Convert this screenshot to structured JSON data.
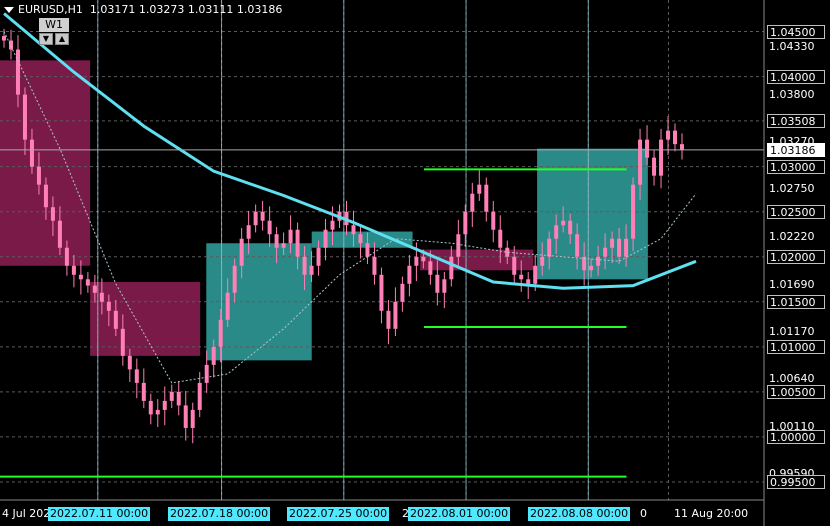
{
  "symbol": {
    "name": "EURUSD,H1",
    "ohlc": "1.03171 1.03273 1.03111 1.03186"
  },
  "timeframe_widget": {
    "label": "W1",
    "down": "▼",
    "up": "▲"
  },
  "price_axis": {
    "boxed": [
      "1.04500",
      "1.04000",
      "1.03508",
      "1.03000",
      "1.02500",
      "1.02000",
      "1.01500",
      "1.01000",
      "1.00500",
      "1.00000",
      "0.99500"
    ],
    "plain": [
      "1.04330",
      "1.03800",
      "1.03270",
      "1.02750",
      "1.02220",
      "1.01690",
      "1.01170",
      "1.00640",
      "1.00110",
      "0.99590"
    ],
    "current": "1.03186"
  },
  "time_axis": {
    "plain": [
      "4 Jul 2022",
      "2",
      "2",
      "2",
      "0",
      "11 Aug 20:00"
    ],
    "highlighted": [
      "2022.07.11 00:00",
      "2022.07.18 00:00",
      "2022.07.25 00:00",
      "2022.08.01 00:00",
      "2022.08.08 00:00"
    ]
  },
  "colors": {
    "background": "#000000",
    "grid": "#5a5a5a",
    "period_separator": "#9ad8e8",
    "candle": "#ff7fb6",
    "ma_thick": "#5fe0f0",
    "ma_thin": "#a8c8d0",
    "green_line": "#22ff22",
    "zone_magenta": "#7a1a48",
    "zone_teal": "#2a8a88",
    "highlight": "#4ee8ff"
  },
  "chart_data": {
    "type": "candlestick",
    "symbol": "EURUSD",
    "timeframe": "H1",
    "x_range": [
      "2022-07-04",
      "2022-08-11"
    ],
    "ylim": [
      0.993,
      1.0485
    ],
    "grid": true,
    "price_ticks": [
      1.045,
      1.0433,
      1.04,
      1.038,
      1.03508,
      1.0327,
      1.03,
      1.0275,
      1.025,
      1.0222,
      1.02,
      1.0169,
      1.015,
      1.0117,
      1.01,
      1.0064,
      1.005,
      1.0011,
      1.0,
      0.9959,
      0.995
    ],
    "current_price": 1.03186,
    "weekly_separators": [
      "2022-07-11",
      "2022-07-18",
      "2022-07-25",
      "2022-08-01",
      "2022-08-08"
    ],
    "close_series": [
      1.044,
      1.043,
      1.038,
      1.033,
      1.03,
      1.028,
      1.0255,
      1.024,
      1.021,
      1.019,
      1.018,
      1.0175,
      1.0168,
      1.016,
      1.015,
      1.014,
      1.012,
      1.009,
      1.0075,
      1.006,
      1.004,
      1.0025,
      1.003,
      1.004,
      1.005,
      1.0035,
      1.001,
      1.003,
      1.006,
      1.008,
      1.01,
      1.013,
      1.016,
      1.019,
      1.022,
      1.0235,
      1.025,
      1.024,
      1.0225,
      1.021,
      1.0215,
      1.023,
      1.02,
      1.018,
      1.019,
      1.021,
      1.023,
      1.024,
      1.025,
      1.0235,
      1.0225,
      1.0215,
      1.02,
      1.018,
      1.014,
      1.012,
      1.015,
      1.017,
      1.019,
      1.02,
      1.0195,
      1.018,
      1.016,
      1.0175,
      1.02,
      1.0225,
      1.025,
      1.027,
      1.028,
      1.025,
      1.023,
      1.021,
      1.02,
      1.018,
      1.0175,
      1.017,
      1.019,
      1.02,
      1.022,
      1.0235,
      1.024,
      1.0225,
      1.02,
      1.0185,
      1.019,
      1.02,
      1.021,
      1.022,
      1.02,
      1.022,
      1.028,
      1.033,
      1.031,
      1.029,
      1.033,
      1.034,
      1.0325,
      1.0319
    ],
    "ma_thick_keys": [
      [
        0,
        1.047
      ],
      [
        10,
        1.0405
      ],
      [
        20,
        1.0345
      ],
      [
        30,
        1.0295
      ],
      [
        40,
        1.0268
      ],
      [
        50,
        1.0238
      ],
      [
        60,
        1.0205
      ],
      [
        70,
        1.0172
      ],
      [
        80,
        1.0165
      ],
      [
        90,
        1.0168
      ],
      [
        99,
        1.0195
      ]
    ],
    "ma_thin_keys": [
      [
        0,
        1.045
      ],
      [
        8,
        1.032
      ],
      [
        16,
        1.017
      ],
      [
        24,
        1.006
      ],
      [
        32,
        1.007
      ],
      [
        40,
        1.012
      ],
      [
        48,
        1.018
      ],
      [
        56,
        1.022
      ],
      [
        64,
        1.0215
      ],
      [
        72,
        1.0205
      ],
      [
        80,
        1.02
      ],
      [
        88,
        1.0195
      ],
      [
        94,
        1.022
      ],
      [
        99,
        1.027
      ]
    ],
    "horizontal_levels": [
      {
        "price": 1.0297,
        "x_from": 0.555,
        "x_to": 0.82
      },
      {
        "price": 1.0122,
        "x_from": 0.555,
        "x_to": 0.82
      },
      {
        "price": 0.9956,
        "x_from": 0.0,
        "x_to": 0.82
      }
    ],
    "zones": [
      {
        "type": "magenta",
        "x0": 0.0,
        "x1": 0.118,
        "y0": 1.0418,
        "y1": 1.019
      },
      {
        "type": "magenta",
        "x0": 0.118,
        "x1": 0.262,
        "y0": 1.0172,
        "y1": 1.009
      },
      {
        "type": "teal",
        "x0": 0.27,
        "x1": 0.408,
        "y0": 1.0215,
        "y1": 1.0085
      },
      {
        "type": "teal",
        "x0": 0.408,
        "x1": 0.54,
        "y0": 1.0228,
        "y1": 1.021
      },
      {
        "type": "magenta",
        "x0": 0.55,
        "x1": 0.698,
        "y0": 1.0208,
        "y1": 1.0185
      },
      {
        "type": "teal",
        "x0": 0.703,
        "x1": 0.848,
        "y0": 1.032,
        "y1": 1.0175
      }
    ]
  }
}
